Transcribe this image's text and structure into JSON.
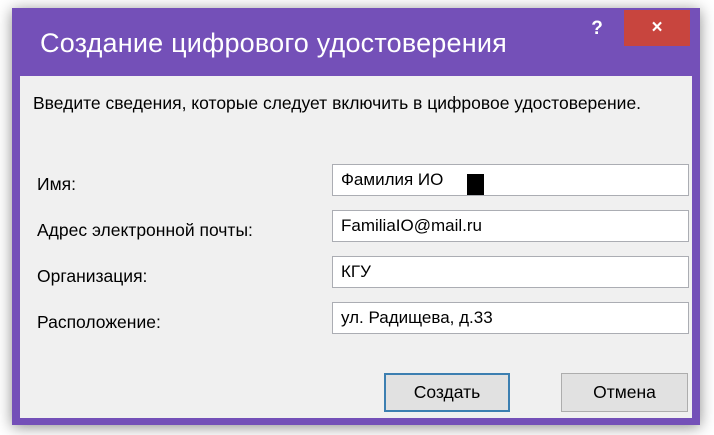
{
  "dialog": {
    "title": "Создание цифрового удостоверения",
    "help_label": "?",
    "close_label": "×"
  },
  "form": {
    "intro": "Введите сведения, которые следует включить в цифровое удостоверение.",
    "name_label": "Имя:",
    "name_value": "Фамилия ИО",
    "email_label": "Адрес электронной почты:",
    "email_value": "FamiliaIO@mail.ru",
    "org_label": "Организация:",
    "org_value": "КГУ",
    "location_label": "Расположение:",
    "location_value": "ул. Радищева, д.33"
  },
  "buttons": {
    "create_label": "Создать",
    "cancel_label": "Отмена"
  },
  "colors": {
    "titlebar": "#7450b8",
    "close": "#c8453e",
    "client": "#f0f0f0",
    "default_button_border": "#3c7fb1"
  }
}
